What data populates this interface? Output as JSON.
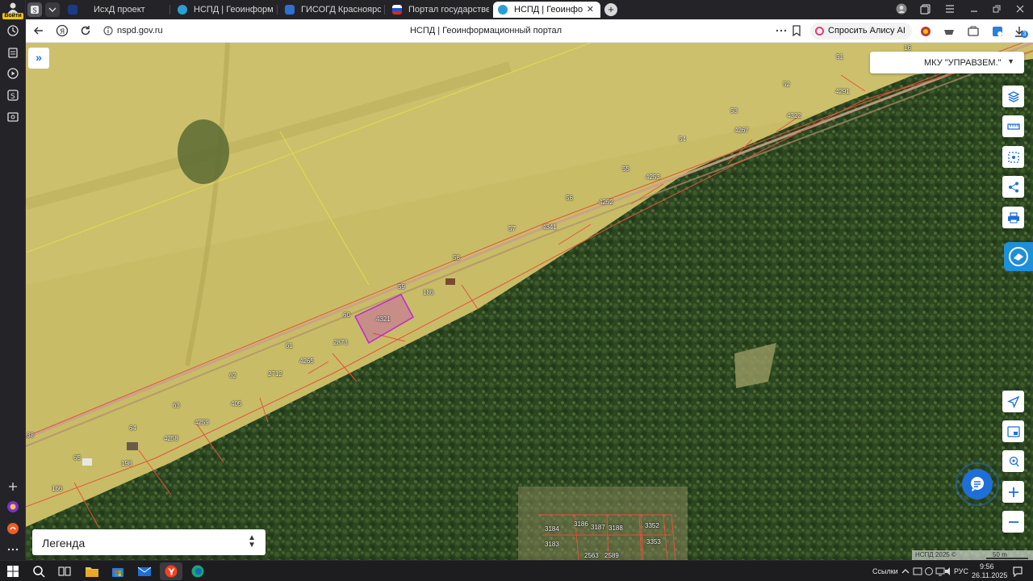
{
  "browser": {
    "login_label": "Войти",
    "tabs": [
      {
        "title": "ИсхД проект",
        "active": false
      },
      {
        "title": "НСПД | Геоинформационный портал",
        "active": false
      },
      {
        "title": "ГИСОГД Красноярского края",
        "active": false
      },
      {
        "title": "Портал государственных услуг",
        "active": false
      },
      {
        "title": "НСПД | Геоинформационный портал",
        "active": true
      }
    ],
    "new_tab_label": "+",
    "url": "nspd.gov.ru",
    "page_title": "НСПД | Геоинформационный портал",
    "alice_label": "Спросить Алису AI",
    "downloads_count": "3"
  },
  "map": {
    "organization": "МКУ \"УПРАВЗЕМ.\"",
    "legend_label": "Легенда",
    "attribution": "НСПД 2025 ©",
    "scale_label": "50 m",
    "selected_parcel": "4321",
    "parcel_labels": [
      "16",
      "51",
      "52",
      "4291",
      "53",
      "4322",
      "4267",
      "54",
      "55",
      "4253",
      "56",
      "4252",
      "57",
      "4341",
      "58",
      "186",
      "59",
      "4321",
      "60",
      "2873",
      "61",
      "4265",
      "62",
      "2712",
      "405",
      "63",
      "4259",
      "64",
      "4258",
      "198",
      "65",
      "166",
      "38",
      "3184",
      "3186",
      "3187",
      "3188",
      "3352",
      "3183",
      "3353",
      "2563",
      "2589"
    ]
  },
  "taskbar": {
    "links_label": "Ссылки",
    "language": "РУС",
    "time": "9:56",
    "date": "26.11.2025"
  },
  "colors": {
    "accent": "#1e6fd9",
    "parcel_border": "#e0553c",
    "selected_parcel": "#c026d3",
    "field": "#cbbd66",
    "forest": "#2f4a22"
  }
}
